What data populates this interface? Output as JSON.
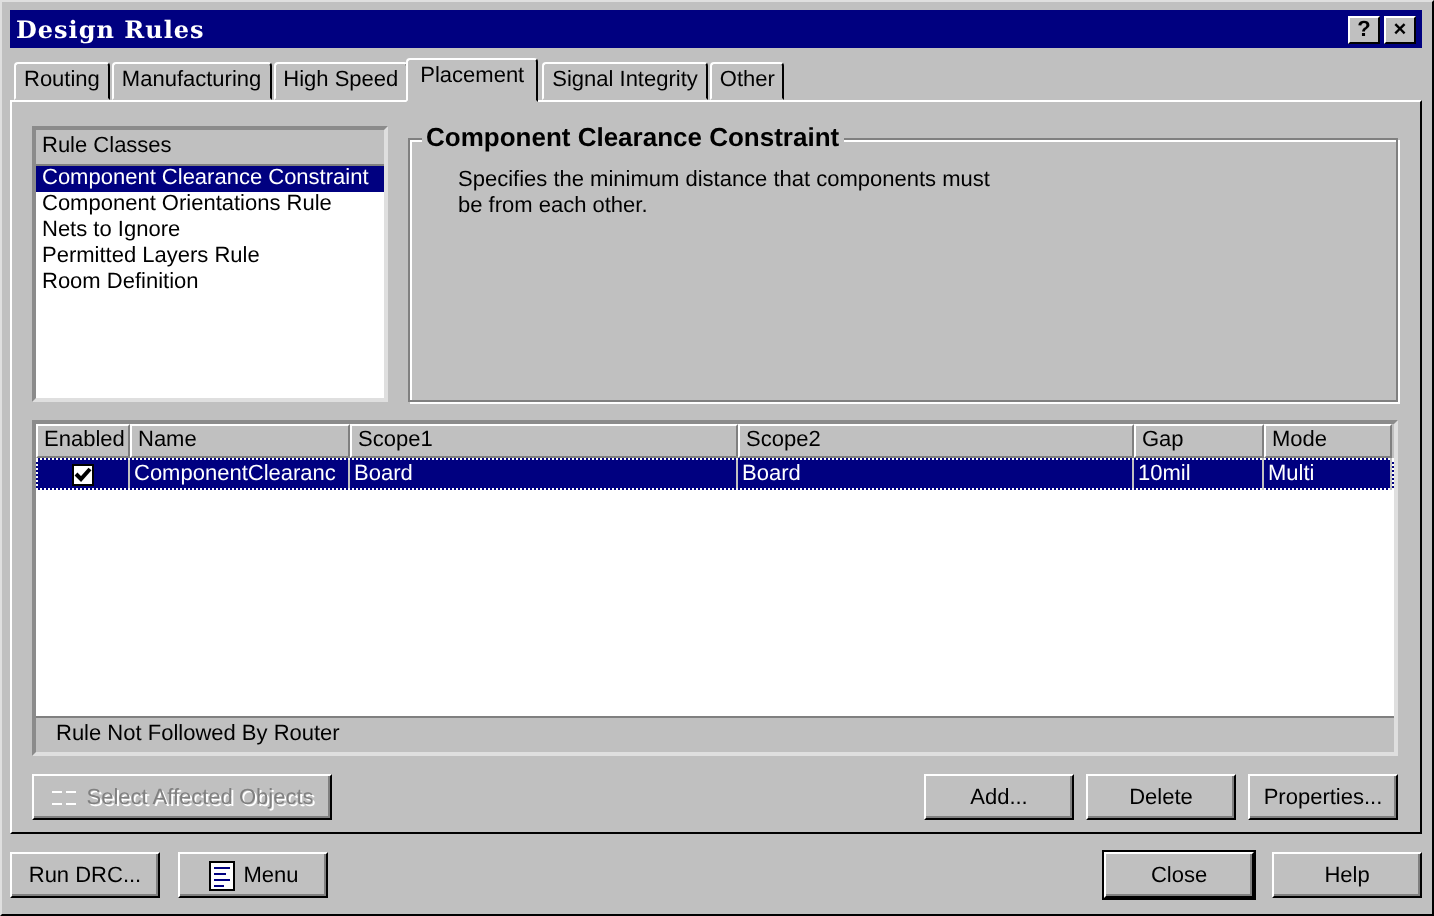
{
  "window": {
    "title": "Design Rules",
    "title_buttons": [
      "?",
      "×"
    ]
  },
  "tabs": [
    {
      "label": "Routing",
      "selected": false
    },
    {
      "label": "Manufacturing",
      "selected": false
    },
    {
      "label": "High Speed",
      "selected": false
    },
    {
      "label": "Placement",
      "selected": true
    },
    {
      "label": "Signal Integrity",
      "selected": false
    },
    {
      "label": "Other",
      "selected": false
    }
  ],
  "rule_classes": {
    "header": "Rule Classes",
    "items": [
      {
        "label": "Component Clearance Constraint",
        "selected": true
      },
      {
        "label": "Component Orientations Rule",
        "selected": false
      },
      {
        "label": "Nets to Ignore",
        "selected": false
      },
      {
        "label": "Permitted Layers Rule",
        "selected": false
      },
      {
        "label": "Room Definition",
        "selected": false
      }
    ]
  },
  "description": {
    "title": "Component Clearance Constraint",
    "text": "Specifies the minimum distance that components must be from each other."
  },
  "table": {
    "columns": [
      "Enabled",
      "Name",
      "Scope1",
      "Scope2",
      "Gap",
      "Mode"
    ],
    "rows": [
      {
        "enabled": true,
        "selected": true,
        "cells": [
          "",
          "ComponentClearanc",
          "Board",
          "Board",
          "10mil",
          "Multi"
        ]
      }
    ],
    "footer": "Rule Not Followed By Router"
  },
  "actions": [
    {
      "label": "Select Affected Objects",
      "disabled": true,
      "kind": "select"
    },
    {
      "label": "Add...",
      "disabled": false,
      "kind": "plain"
    },
    {
      "label": "Delete",
      "disabled": false,
      "kind": "plain"
    },
    {
      "label": "Properties...",
      "disabled": false,
      "kind": "plain"
    }
  ],
  "bottom_buttons": [
    {
      "label": "Run DRC...",
      "kind": "plain",
      "default": false
    },
    {
      "label": "Menu",
      "kind": "menu",
      "default": false
    },
    {
      "label": "Close",
      "kind": "plain",
      "default": true
    },
    {
      "label": "Help",
      "kind": "plain",
      "default": false
    }
  ]
}
